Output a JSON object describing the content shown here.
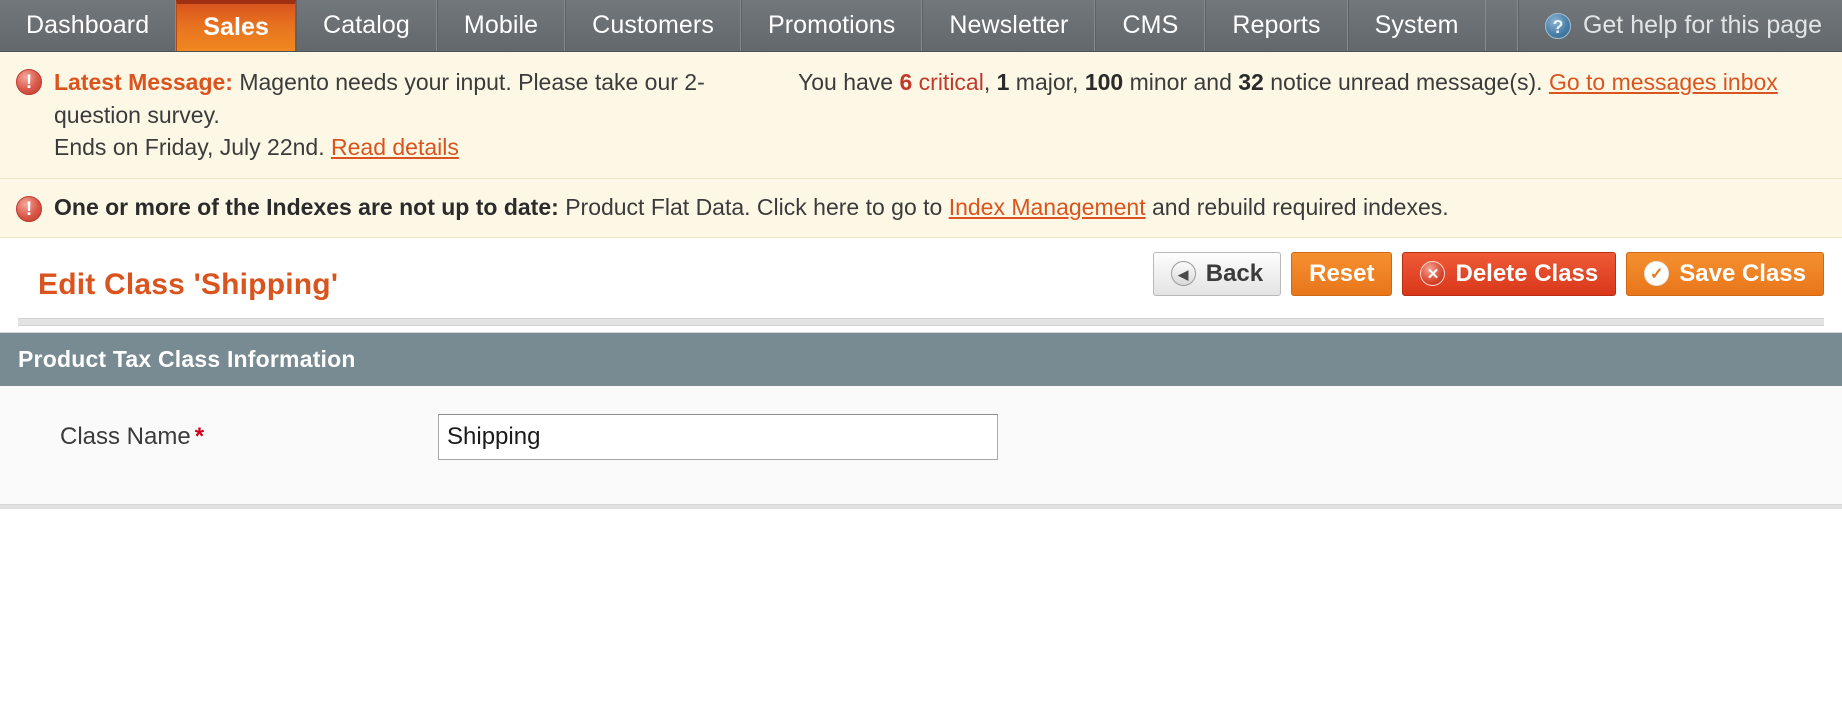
{
  "nav": {
    "items": [
      {
        "label": "Dashboard",
        "active": false
      },
      {
        "label": "Sales",
        "active": true
      },
      {
        "label": "Catalog",
        "active": false
      },
      {
        "label": "Mobile",
        "active": false
      },
      {
        "label": "Customers",
        "active": false
      },
      {
        "label": "Promotions",
        "active": false
      },
      {
        "label": "Newsletter",
        "active": false
      },
      {
        "label": "CMS",
        "active": false
      },
      {
        "label": "Reports",
        "active": false
      },
      {
        "label": "System",
        "active": false
      }
    ],
    "help_label": "Get help for this page",
    "help_icon": "question-mark-circle-icon",
    "active_color": "#e7721f",
    "bar_color": "#6a6f73"
  },
  "messages": {
    "latest": {
      "icon": "alert-circle-icon",
      "title": "Latest Message:",
      "text": "Magento needs your input. Please take our 2-question survey.",
      "line2_prefix": "Ends on Friday, July 22nd.",
      "line2_link": "Read details",
      "counts_prefix": "You have",
      "critical_count": "6",
      "critical_word": "critical",
      "sep1": ",",
      "major_count": "1",
      "major_word": "major,",
      "minor_count": "100",
      "minor_word": "minor and",
      "notice_count": "32",
      "notice_word": "notice unread message(s).",
      "inbox_link": "Go to messages inbox"
    },
    "index": {
      "icon": "alert-circle-icon",
      "title": "One or more of the Indexes are not up to date:",
      "text_before": "Product Flat Data. Click here to go to",
      "link": "Index Management",
      "text_after": "and rebuild required indexes."
    },
    "background_color": "#fdf8e6",
    "link_color": "#d9541e"
  },
  "page": {
    "title": "Edit Class 'Shipping'",
    "title_color": "#d9541e"
  },
  "toolbar": {
    "back_label": "Back",
    "back_icon": "arrow-left-circle-icon",
    "reset_label": "Reset",
    "delete_label": "Delete Class",
    "delete_icon": "x-circle-icon",
    "save_label": "Save Class",
    "save_icon": "check-circle-icon"
  },
  "panel": {
    "header": "Product Tax Class Information",
    "header_color": "#798b92",
    "fields": [
      {
        "label": "Class Name",
        "required_marker": "*",
        "value": "Shipping",
        "placeholder": ""
      }
    ]
  }
}
